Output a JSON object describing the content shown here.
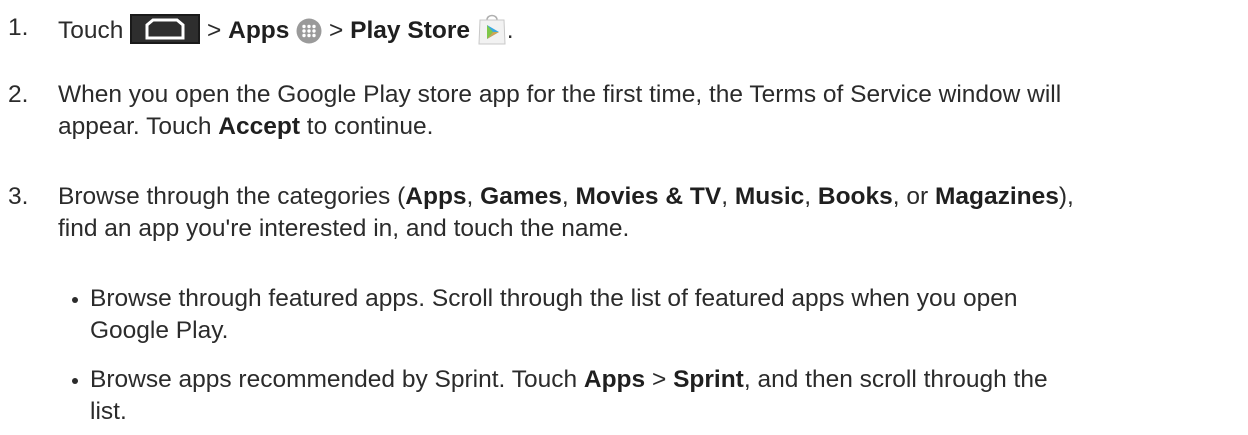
{
  "steps": [
    {
      "number": "1.",
      "touch": "Touch",
      "sep1": ">",
      "apps": "Apps",
      "sep2": ">",
      "play_store": "Play Store",
      "end": ".",
      "icons": [
        "home-button-icon",
        "apps-grid-icon",
        "play-store-icon"
      ]
    },
    {
      "number": "2.",
      "line1": "When you open the Google Play store app for the first time, the Terms of Service window will",
      "line2_pre": "appear. Touch ",
      "accept": "Accept",
      "line2_post": " to continue."
    },
    {
      "number": "3.",
      "t1": "Browse through the categories (",
      "apps": "Apps",
      "c1": ", ",
      "games": "Games",
      "c2": ", ",
      "movies": "Movies & TV",
      "c3": ", ",
      "music": "Music",
      "c4": ", ",
      "books": "Books",
      "c5": ", or ",
      "magazines": "Magazines",
      "t2": "),",
      "line2": "find an app you're interested in, and touch the name."
    }
  ],
  "bullets": [
    {
      "line1": "Browse through featured apps. Scroll through the list of featured apps when you open",
      "line2": "Google Play."
    },
    {
      "pre": "Browse apps recommended by Sprint. Touch ",
      "apps": "Apps",
      "sep": " > ",
      "sprint": "Sprint",
      "post": ", and then scroll through the",
      "line2": "list."
    }
  ]
}
